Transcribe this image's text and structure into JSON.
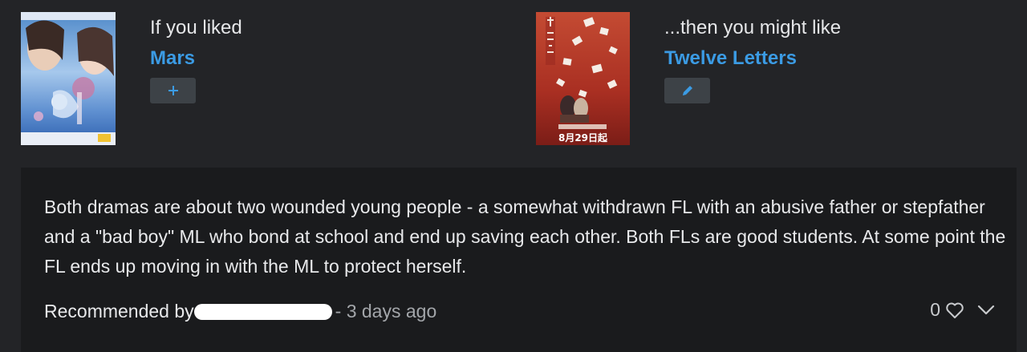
{
  "left": {
    "lead": "If you liked",
    "title": "Mars",
    "action": "add"
  },
  "right": {
    "lead": "...then you might like",
    "title": "Twelve Letters",
    "poster_text": "8月29日起",
    "action": "edit"
  },
  "review": {
    "text": "Both dramas are about two wounded young people - a somewhat withdrawn FL with an abusive father or stepfather and a \"bad boy\" ML who bond at school and end up saving each other. Both FLs are good students. At some point the FL ends up moving in with the ML to protect herself."
  },
  "footer": {
    "recommended_label": "Recommended by",
    "time": "- 3 days ago",
    "like_count": "0"
  },
  "colors": {
    "link": "#3b9be4",
    "background": "#232427",
    "card": "#1a1b1d",
    "button": "#3d4247"
  },
  "icons": {
    "add": "plus-icon",
    "edit": "pencil-icon",
    "like": "heart-icon",
    "expand": "chevron-down-icon"
  }
}
